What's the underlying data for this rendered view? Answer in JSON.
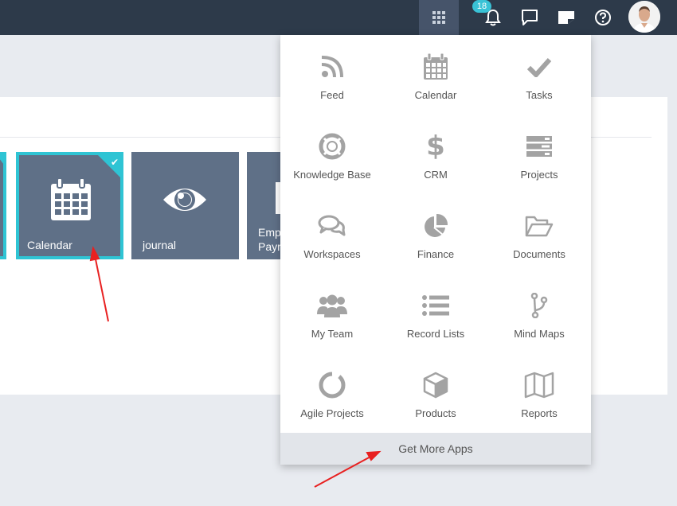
{
  "topbar": {
    "notification_count": "18"
  },
  "tiles": [
    {
      "label": "Calendar",
      "selected": true
    },
    {
      "label": "journal",
      "selected": false
    },
    {
      "label": "Emp\nPayr",
      "line1": "Emp",
      "line2": "Payr",
      "selected": false
    }
  ],
  "apps_menu": {
    "items": [
      {
        "label": "Feed",
        "icon": "rss-icon"
      },
      {
        "label": "Calendar",
        "icon": "calendar-icon"
      },
      {
        "label": "Tasks",
        "icon": "check-icon"
      },
      {
        "label": "Knowledge Base",
        "icon": "lifebuoy-icon"
      },
      {
        "label": "CRM",
        "icon": "dollar-icon"
      },
      {
        "label": "Projects",
        "icon": "server-icon"
      },
      {
        "label": "Workspaces",
        "icon": "chat-bubbles-icon"
      },
      {
        "label": "Finance",
        "icon": "pie-chart-icon"
      },
      {
        "label": "Documents",
        "icon": "folder-open-icon"
      },
      {
        "label": "My Team",
        "icon": "team-icon"
      },
      {
        "label": "Record Lists",
        "icon": "list-icon"
      },
      {
        "label": "Mind Maps",
        "icon": "branch-icon"
      },
      {
        "label": "Agile Projects",
        "icon": "ring-icon"
      },
      {
        "label": "Products",
        "icon": "cube-icon"
      },
      {
        "label": "Reports",
        "icon": "map-icon"
      }
    ],
    "more_label": "Get More Apps"
  },
  "colors": {
    "topbar": "#2d3a4a",
    "accent": "#2fc4d4",
    "tile": "#5f7087",
    "icon": "#a3a3a3"
  }
}
